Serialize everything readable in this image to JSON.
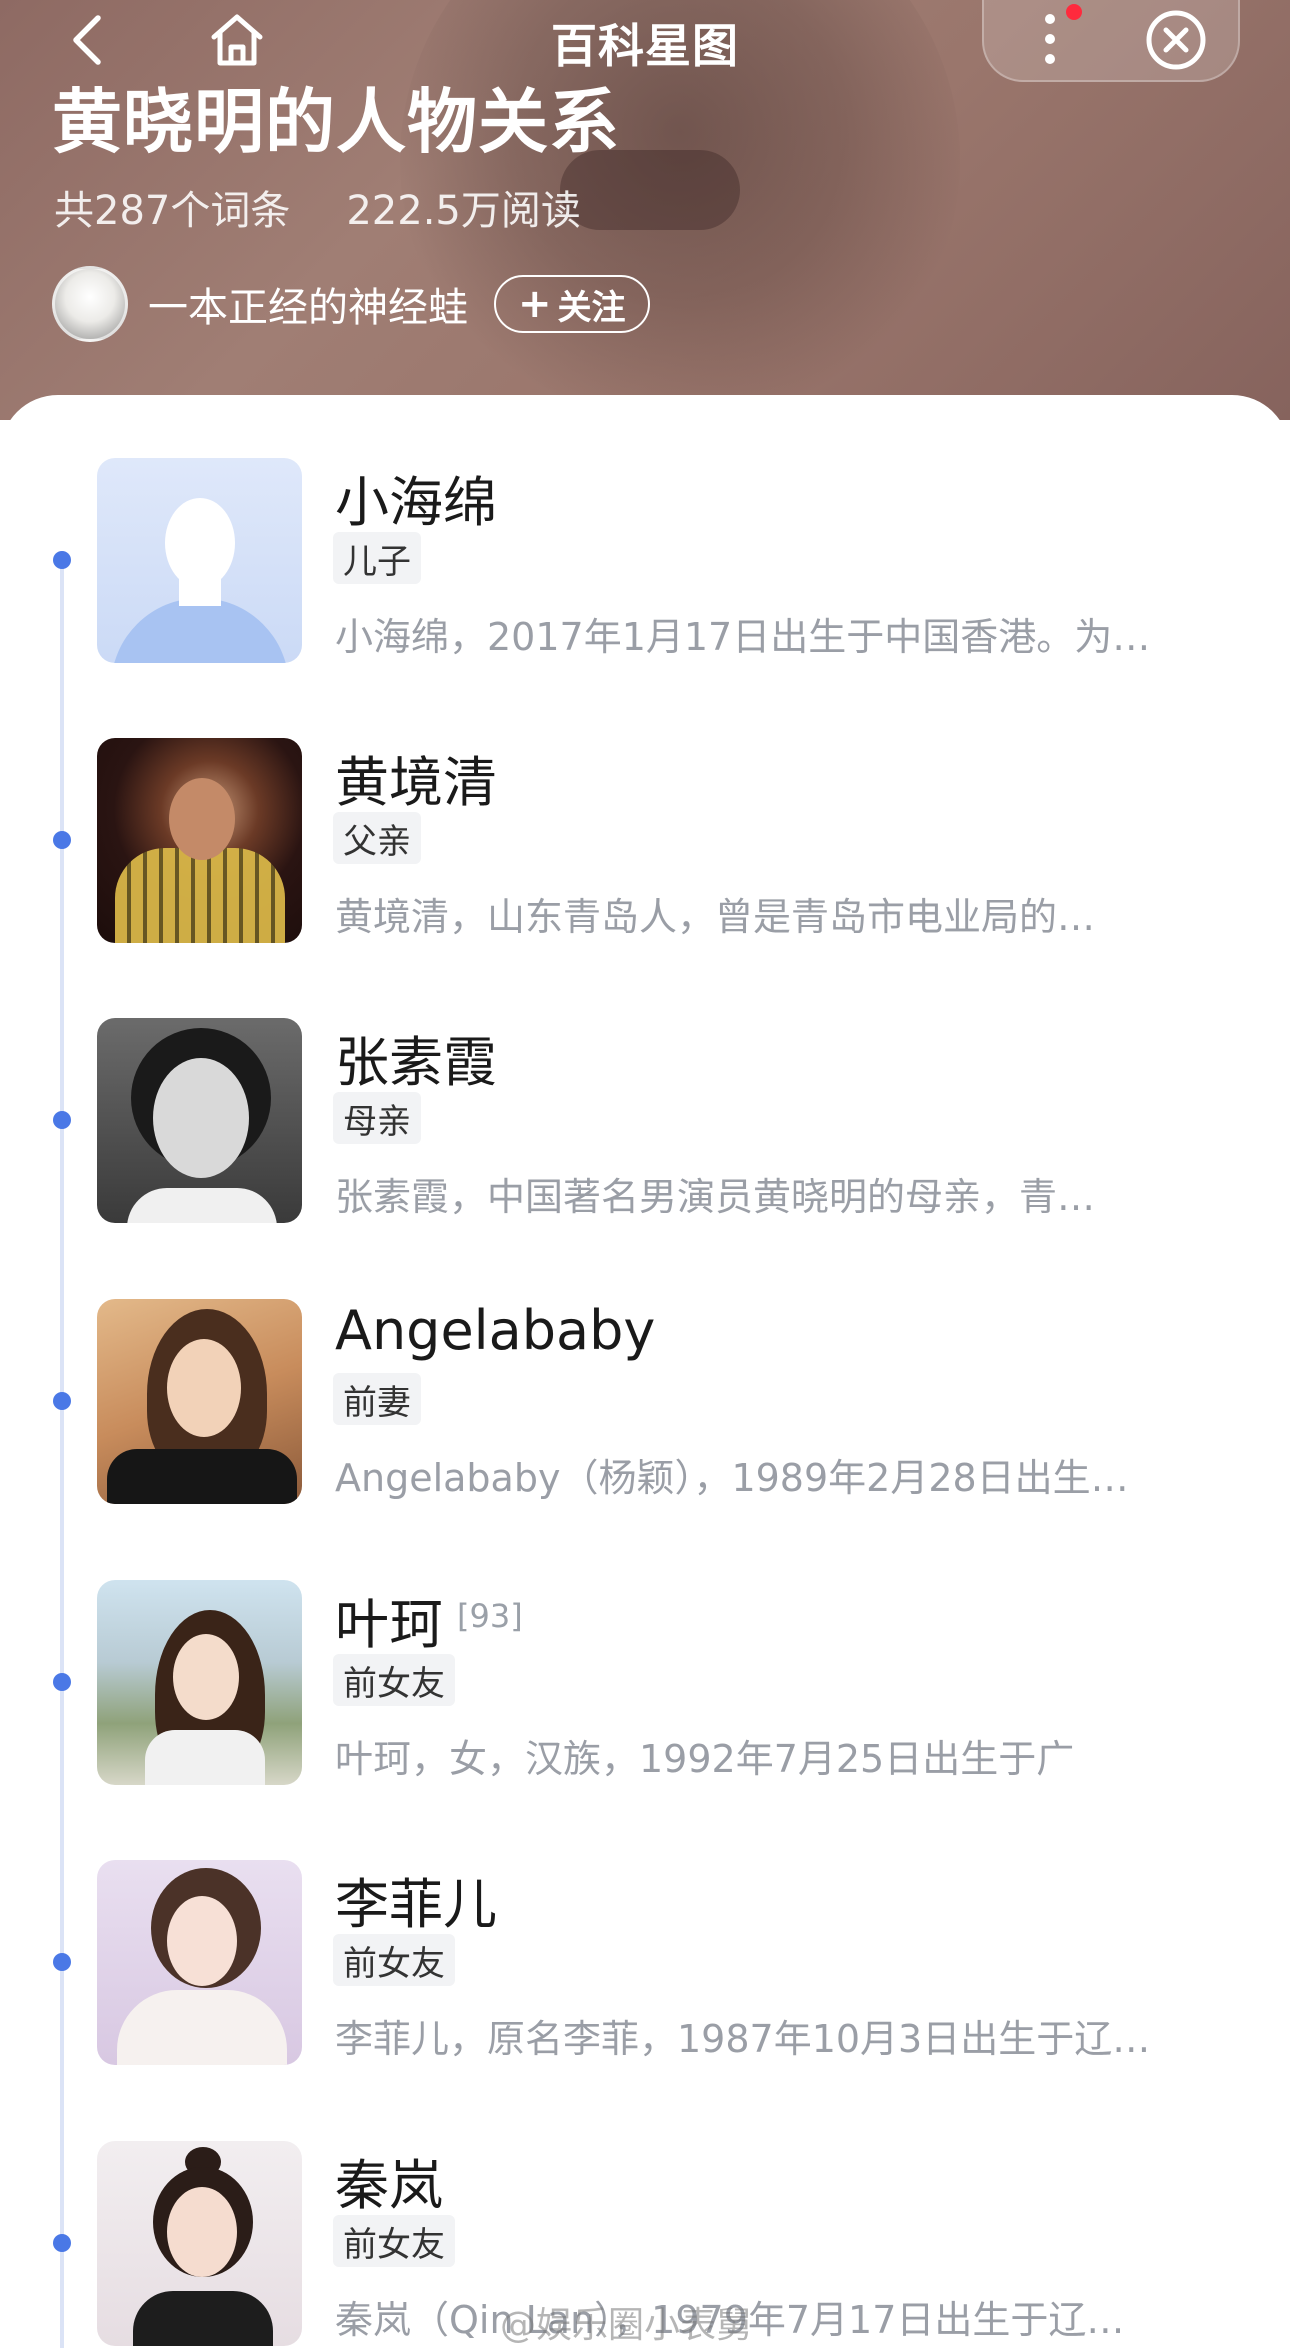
{
  "nav": {
    "title": "百科星图"
  },
  "header": {
    "page_title": "黄晓明的人物关系",
    "entries_count": "共287个词条",
    "reads_count": "222.5万阅读",
    "author_name": "一本正经的神经蛙",
    "follow_label": "关注"
  },
  "items": [
    {
      "name": "小海绵",
      "relation": "儿子",
      "desc": "小海绵，2017年1月17日出生于中国香港。为…"
    },
    {
      "name": "黄境清",
      "relation": "父亲",
      "desc": "黄境清，山东青岛人，曾是青岛市电业局的…"
    },
    {
      "name": "张素霞",
      "relation": "母亲",
      "desc": "张素霞，中国著名男演员黄晓明的母亲，青…"
    },
    {
      "name": "Angelababy",
      "relation": "前妻",
      "desc": "Angelababy（杨颖），1989年2月28日出生…"
    },
    {
      "name": "叶珂",
      "cite": "[93]",
      "relation": "前女友",
      "desc": "叶珂，女，汉族，1992年7月25日出生于广"
    },
    {
      "name": "李菲儿",
      "relation": "前女友",
      "desc": "李菲儿，原名李菲，1987年10月3日出生于辽…"
    },
    {
      "name": "秦岚",
      "relation": "前女友",
      "desc": "秦岚（Qin Lan），1979年7月17日出生于辽…"
    }
  ],
  "watermark": "@娱乐圈小表舅",
  "icons": [
    "back-icon",
    "home-icon",
    "more-icon",
    "close-icon",
    "plus-icon"
  ],
  "colors": {
    "timeline_dot": "#4a78e6",
    "header_bg": "#9a766c"
  }
}
